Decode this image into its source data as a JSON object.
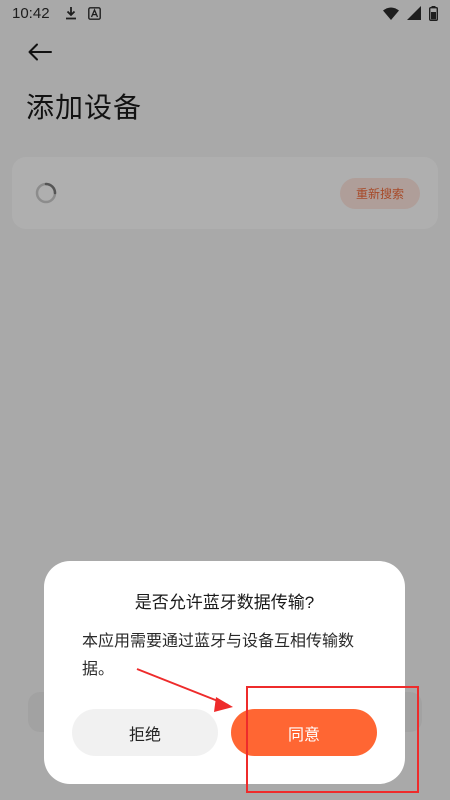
{
  "status_bar": {
    "time": "10:42",
    "left_icons": [
      "download-icon",
      "notification-a-icon"
    ],
    "right_icons": [
      "wifi-icon",
      "signal-icon",
      "battery-icon"
    ]
  },
  "page": {
    "back_icon": "back-arrow-icon",
    "title": "添加设备",
    "device_card": {
      "spinner_icon": "loading-spinner-icon",
      "rescan_label": "重新搜索"
    }
  },
  "dialog": {
    "title": "是否允许蓝牙数据传输?",
    "message": "本应用需要通过蓝牙与设备互相传输数据。",
    "refuse_label": "拒绝",
    "agree_label": "同意"
  },
  "colors": {
    "accent": "#ff6633",
    "rescan_text": "#ef6b3b",
    "annotation": "#ee2b2b"
  }
}
